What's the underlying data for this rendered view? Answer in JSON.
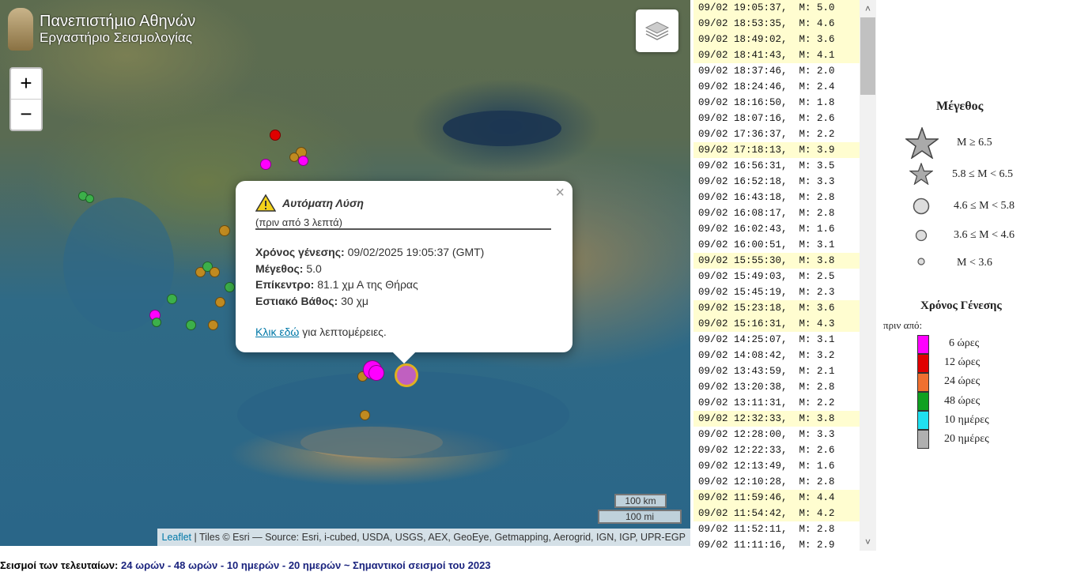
{
  "logo": {
    "line1": "Πανεπιστήμιο Αθηνών",
    "line2": "Εργαστήριο Σεισμολογίας"
  },
  "zoom": {
    "in_label": "+",
    "out_label": "−"
  },
  "popup": {
    "title": "Αυτόματη Λύση",
    "subtitle": "(πριν από 3 λεπτά)",
    "time_label": "Χρόνος γένεσης:",
    "time_value": "09/02/2025 19:05:37 (GMT)",
    "magnitude_label": "Μέγεθος:",
    "magnitude_value": "5.0",
    "epicenter_label": "Επίκεντρο:",
    "epicenter_value": "81.1 χμ Α της Θήρας",
    "depth_label": "Εστιακό Βάθος:",
    "depth_value": "30 χμ",
    "link_text": "Κλικ εδώ",
    "link_suffix": "για λεπτομέρειες.",
    "close_label": "×"
  },
  "scale": {
    "km": "100 km",
    "mi": "100 mi"
  },
  "attribution": {
    "leaflet": "Leaflet",
    "text": "| Tiles © Esri — Source: Esri, i-cubed, USDA, USGS, AEX, GeoEye, Getmapping, Aerogrid, IGN, IGP, UPR-EGP"
  },
  "events": [
    {
      "t": "09/02 19:05:37,  M: 5.0",
      "hl": true
    },
    {
      "t": "09/02 18:53:35,  M: 4.6",
      "hl": true
    },
    {
      "t": "09/02 18:49:02,  M: 3.6",
      "hl": true
    },
    {
      "t": "09/02 18:41:43,  M: 4.1",
      "hl": true
    },
    {
      "t": "09/02 18:37:46,  M: 2.0",
      "hl": false
    },
    {
      "t": "09/02 18:24:46,  M: 2.4",
      "hl": false
    },
    {
      "t": "09/02 18:16:50,  M: 1.8",
      "hl": false
    },
    {
      "t": "09/02 18:07:16,  M: 2.6",
      "hl": false
    },
    {
      "t": "09/02 17:36:37,  M: 2.2",
      "hl": false
    },
    {
      "t": "09/02 17:18:13,  M: 3.9",
      "hl": true
    },
    {
      "t": "09/02 16:56:31,  M: 3.5",
      "hl": false
    },
    {
      "t": "09/02 16:52:18,  M: 3.3",
      "hl": false
    },
    {
      "t": "09/02 16:43:18,  M: 2.8",
      "hl": false
    },
    {
      "t": "09/02 16:08:17,  M: 2.8",
      "hl": false
    },
    {
      "t": "09/02 16:02:43,  M: 1.6",
      "hl": false
    },
    {
      "t": "09/02 16:00:51,  M: 3.1",
      "hl": false
    },
    {
      "t": "09/02 15:55:30,  M: 3.8",
      "hl": true
    },
    {
      "t": "09/02 15:49:03,  M: 2.5",
      "hl": false
    },
    {
      "t": "09/02 15:45:19,  M: 2.3",
      "hl": false
    },
    {
      "t": "09/02 15:23:18,  M: 3.6",
      "hl": true
    },
    {
      "t": "09/02 15:16:31,  M: 4.3",
      "hl": true
    },
    {
      "t": "09/02 14:25:07,  M: 3.1",
      "hl": false
    },
    {
      "t": "09/02 14:08:42,  M: 3.2",
      "hl": false
    },
    {
      "t": "09/02 13:43:59,  M: 2.1",
      "hl": false
    },
    {
      "t": "09/02 13:20:38,  M: 2.8",
      "hl": false
    },
    {
      "t": "09/02 13:11:31,  M: 2.2",
      "hl": false
    },
    {
      "t": "09/02 12:32:33,  M: 3.8",
      "hl": true
    },
    {
      "t": "09/02 12:28:00,  M: 3.3",
      "hl": false
    },
    {
      "t": "09/02 12:22:33,  M: 2.6",
      "hl": false
    },
    {
      "t": "09/02 12:13:49,  M: 1.6",
      "hl": false
    },
    {
      "t": "09/02 12:10:28,  M: 2.8",
      "hl": false
    },
    {
      "t": "09/02 11:59:46,  M: 4.4",
      "hl": true
    },
    {
      "t": "09/02 11:54:42,  M: 4.2",
      "hl": true
    },
    {
      "t": "09/02 11:52:11,  M: 2.8",
      "hl": false
    },
    {
      "t": "09/02 11:11:16,  M: 2.9",
      "hl": false
    }
  ],
  "legend": {
    "mag_title": "Μέγεθος",
    "mag": [
      "M ≥ 6.5",
      "5.8 ≤  M  < 6.5",
      "4.6 ≤  M  < 5.8",
      "3.6 ≤  M  < 4.6",
      "M < 3.6"
    ],
    "time_title": "Χρόνος Γένεσης",
    "time_sub": "πριν από:",
    "time": [
      {
        "label": "6 ώρες",
        "color": "#ff00ff"
      },
      {
        "label": "12 ώρες",
        "color": "#e00000"
      },
      {
        "label": "24 ώρες",
        "color": "#f07030"
      },
      {
        "label": "48 ώρες",
        "color": "#10a020"
      },
      {
        "label": "10 ημέρες",
        "color": "#20e0f0"
      },
      {
        "label": "20 ημέρες",
        "color": "#b0b0b0"
      }
    ]
  },
  "footer": {
    "prefix": "Σεισμοί των τελευταίων:",
    "l24": "24 ωρών",
    "l48": "48 ωρών",
    "l10": "10 ημερών",
    "l20": "20 ημερών",
    "sep": "-",
    "tilde": "~",
    "major": "Σημαντικοί σεισμοί του 2023"
  },
  "colors": {
    "h6": "#ff00ff",
    "h12": "#e00000",
    "h24": "#c08a20",
    "h48": "#3cb04a"
  }
}
